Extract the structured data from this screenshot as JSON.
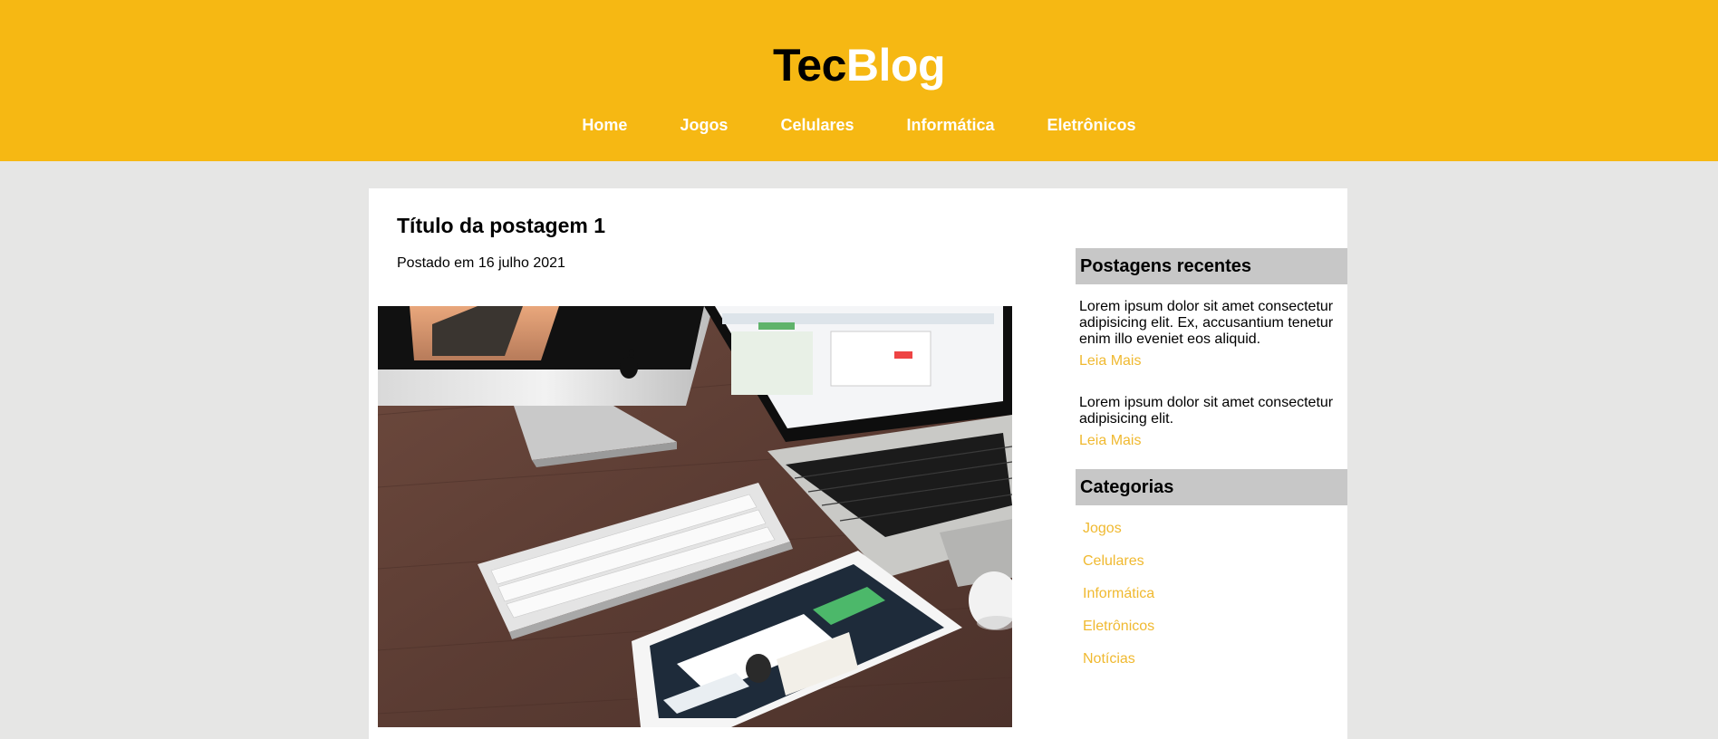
{
  "header": {
    "logo_part1": "Tec",
    "logo_part2": "Blog",
    "nav": [
      "Home",
      "Jogos",
      "Celulares",
      "Informática",
      "Eletrônicos"
    ]
  },
  "post": {
    "title": "Título da postagem 1",
    "date": "Postado em 16 julho 2021"
  },
  "sidebar": {
    "recent_title": "Postagens recentes",
    "recent_posts": [
      {
        "text": "Lorem ipsum dolor sit amet consectetur adipisicing elit. Ex, accusantium tenetur enim illo eveniet eos aliquid.",
        "link": "Leia Mais"
      },
      {
        "text": "Lorem ipsum dolor sit amet consectetur adipisicing elit.",
        "link": "Leia Mais"
      }
    ],
    "categories_title": "Categorias",
    "categories": [
      "Jogos",
      "Celulares",
      "Informática",
      "Eletrônicos",
      "Notícias"
    ]
  },
  "colors": {
    "brand_yellow": "#f6b813",
    "link_yellow": "#f0b930",
    "page_bg": "#e6e6e5",
    "widget_head": "#c7c7c7"
  }
}
